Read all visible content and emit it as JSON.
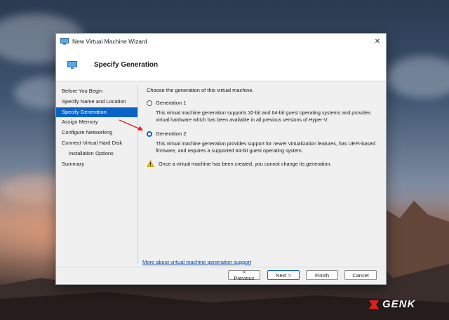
{
  "window": {
    "title": "New Virtual Machine Wizard",
    "heading": "Specify Generation"
  },
  "nav": {
    "items": [
      {
        "label": "Before You Begin"
      },
      {
        "label": "Specify Name and Location"
      },
      {
        "label": "Specify Generation",
        "active": true
      },
      {
        "label": "Assign Memory"
      },
      {
        "label": "Configure Networking"
      },
      {
        "label": "Connect Virtual Hard Disk"
      },
      {
        "label": "Installation Options",
        "sub": true
      },
      {
        "label": "Summary"
      }
    ]
  },
  "content": {
    "intro": "Choose the generation of this virtual machine.",
    "gen1_label": "Generation 1",
    "gen1_desc": "This virtual machine generation supports 32-bit and 64-bit guest operating systems and provides virtual hardware which has been available in all previous versions of Hyper-V.",
    "gen2_label": "Generation 2",
    "gen2_desc": "This virtual machine generation provides support for newer virtualization features, has UEFI-based firmware, and requires a supported 64-bit guest operating system.",
    "selected": "Generation 2",
    "warning": "Once a virtual machine has been created, you cannot change its generation.",
    "more_link": "More about virtual machine generation support"
  },
  "buttons": {
    "previous": "< Previous",
    "next": "Next >",
    "finish": "Finish",
    "cancel": "Cancel"
  },
  "icons": {
    "app": "monitor-icon",
    "warning": "warning-icon",
    "close": "close-icon"
  },
  "colors": {
    "accent": "#0a64c8",
    "warning": "#f2c200",
    "annotation_arrow": "#e0201c"
  },
  "watermark": {
    "text": "GENK"
  }
}
